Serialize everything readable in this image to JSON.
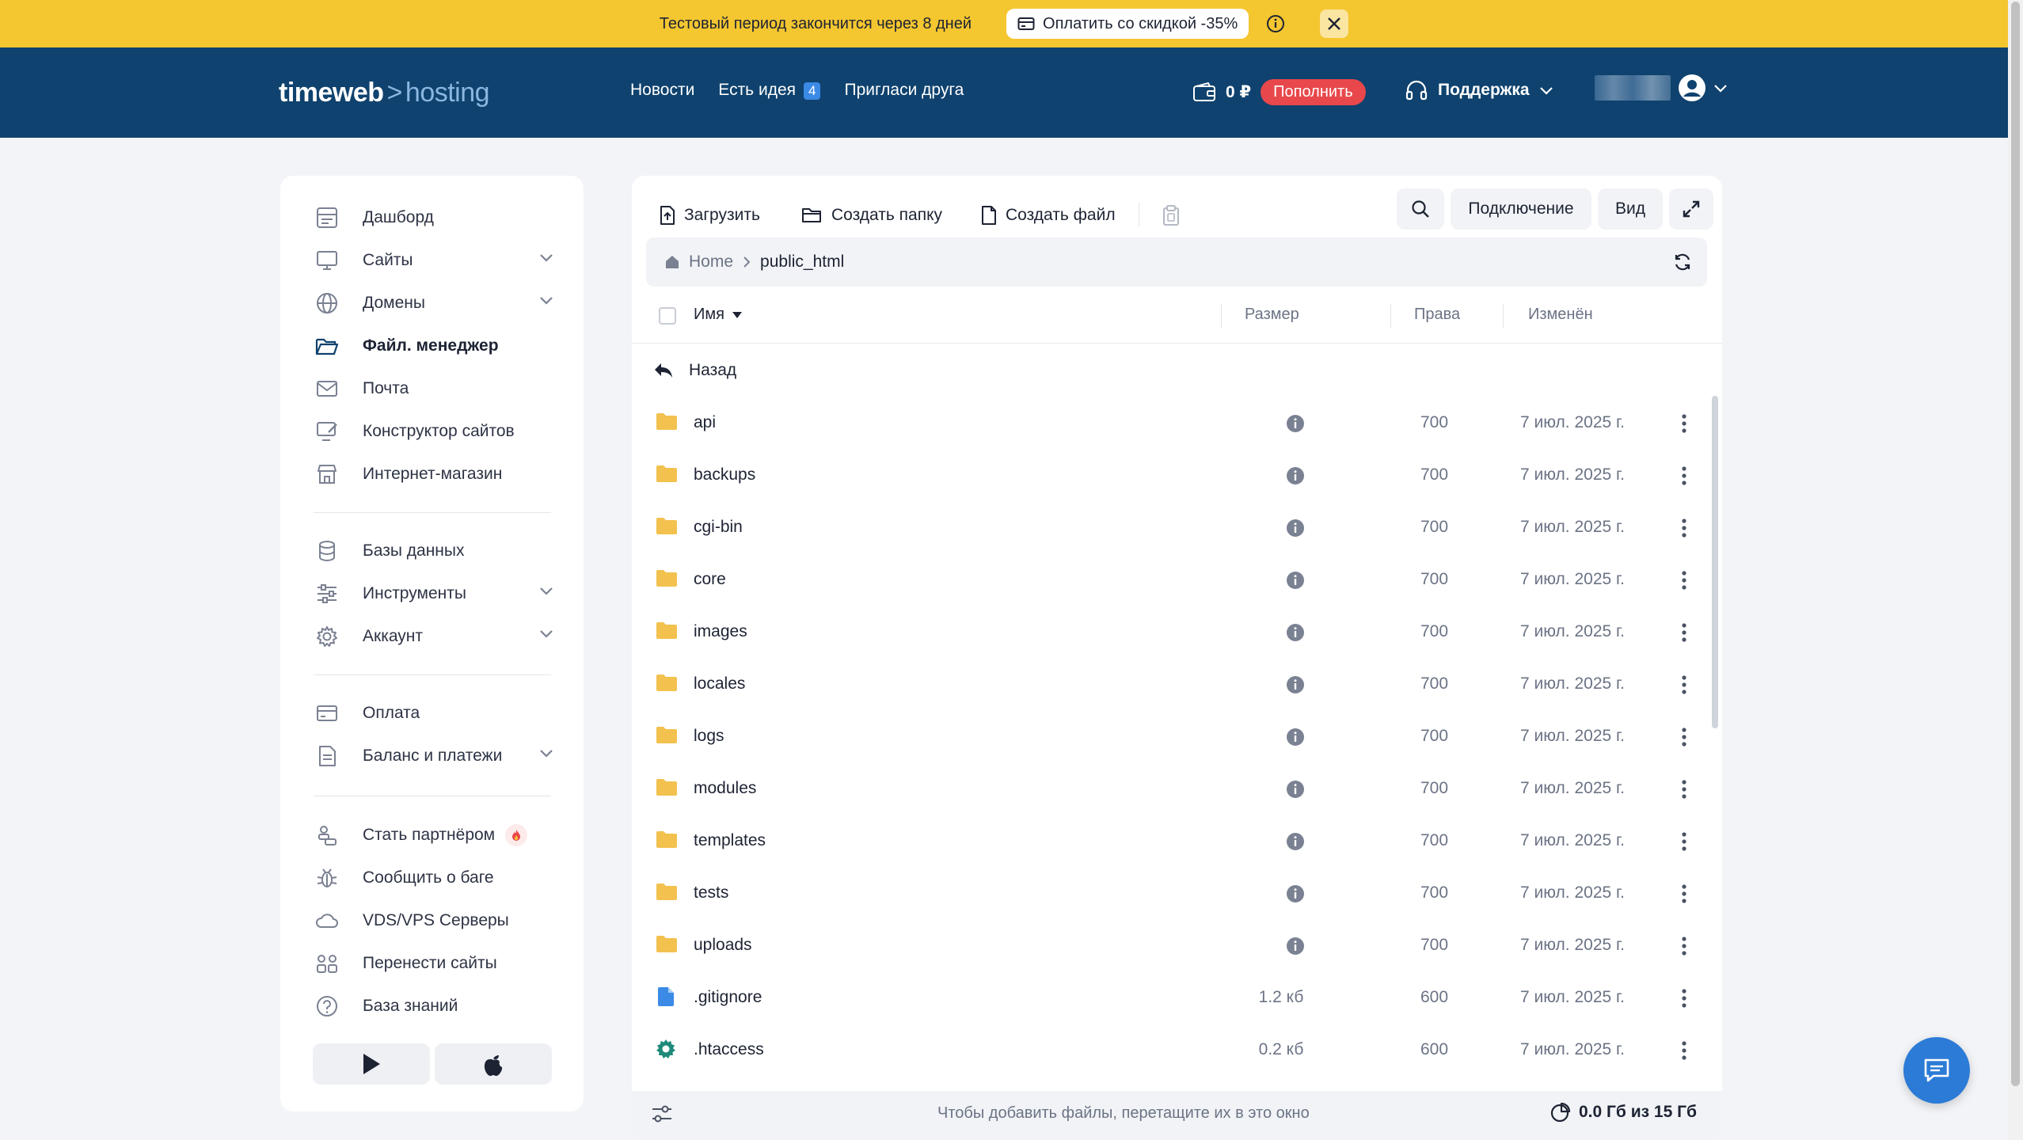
{
  "banner": {
    "text": "Тестовый период закончится через 8 дней",
    "pay_label": "Оплатить со скидкой -35%"
  },
  "header": {
    "logo_main": "timeweb",
    "logo_arrow": ">",
    "logo_sub": "hosting",
    "nav": [
      {
        "label": "Новости"
      },
      {
        "label": "Есть идея",
        "badge": "4"
      },
      {
        "label": "Пригласи друга"
      }
    ],
    "balance": "0 ₽",
    "topup_label": "Пополнить",
    "support_label": "Поддержка"
  },
  "sidebar": {
    "items": [
      {
        "label": "Дашборд",
        "icon": "dashboard-icon"
      },
      {
        "label": "Сайты",
        "icon": "monitor-icon",
        "expandable": true
      },
      {
        "label": "Домены",
        "icon": "globe-icon",
        "expandable": true
      },
      {
        "label": "Файл. менеджер",
        "icon": "folder-open-icon",
        "active": true
      },
      {
        "label": "Почта",
        "icon": "mail-icon"
      },
      {
        "label": "Конструктор сайтов",
        "icon": "builder-icon"
      },
      {
        "label": "Интернет-магазин",
        "icon": "store-icon"
      },
      {
        "label": "Базы данных",
        "icon": "database-icon"
      },
      {
        "label": "Инструменты",
        "icon": "sliders-icon",
        "expandable": true
      },
      {
        "label": "Аккаунт",
        "icon": "gear-icon",
        "expandable": true
      },
      {
        "label": "Оплата",
        "icon": "card-icon"
      },
      {
        "label": "Баланс и платежи",
        "icon": "document-icon",
        "expandable": true
      },
      {
        "label": "Стать партнёром",
        "icon": "partner-icon"
      },
      {
        "label": "Сообщить о баге",
        "icon": "bug-icon"
      },
      {
        "label": "VDS/VPS Серверы",
        "icon": "cloud-icon"
      },
      {
        "label": "Перенести сайты",
        "icon": "transfer-icon"
      },
      {
        "label": "База знаний",
        "icon": "help-icon"
      }
    ]
  },
  "toolbar": {
    "upload": "Загрузить",
    "new_folder": "Создать папку",
    "new_file": "Создать файл",
    "connection": "Подключение",
    "view": "Вид"
  },
  "breadcrumb": {
    "home": "Home",
    "current": "public_html"
  },
  "table": {
    "columns": {
      "name": "Имя",
      "size": "Размер",
      "perms": "Права",
      "modified": "Изменён"
    },
    "back_label": "Назад",
    "rows": [
      {
        "name": "api",
        "type": "folder",
        "size": "",
        "perms": "700",
        "modified": "7 июл. 2025 г."
      },
      {
        "name": "backups",
        "type": "folder",
        "size": "",
        "perms": "700",
        "modified": "7 июл. 2025 г."
      },
      {
        "name": "cgi-bin",
        "type": "folder",
        "size": "",
        "perms": "700",
        "modified": "7 июл. 2025 г."
      },
      {
        "name": "core",
        "type": "folder",
        "size": "",
        "perms": "700",
        "modified": "7 июл. 2025 г."
      },
      {
        "name": "images",
        "type": "folder",
        "size": "",
        "perms": "700",
        "modified": "7 июл. 2025 г."
      },
      {
        "name": "locales",
        "type": "folder",
        "size": "",
        "perms": "700",
        "modified": "7 июл. 2025 г."
      },
      {
        "name": "logs",
        "type": "folder",
        "size": "",
        "perms": "700",
        "modified": "7 июл. 2025 г."
      },
      {
        "name": "modules",
        "type": "folder",
        "size": "",
        "perms": "700",
        "modified": "7 июл. 2025 г."
      },
      {
        "name": "templates",
        "type": "folder",
        "size": "",
        "perms": "700",
        "modified": "7 июл. 2025 г."
      },
      {
        "name": "tests",
        "type": "folder",
        "size": "",
        "perms": "700",
        "modified": "7 июл. 2025 г."
      },
      {
        "name": "uploads",
        "type": "folder",
        "size": "",
        "perms": "700",
        "modified": "7 июл. 2025 г."
      },
      {
        "name": ".gitignore",
        "type": "file",
        "size": "1.2 кб",
        "perms": "600",
        "modified": "7 июл. 2025 г."
      },
      {
        "name": ".htaccess",
        "type": "config",
        "size": "0.2 кб",
        "perms": "600",
        "modified": "7 июл. 2025 г."
      }
    ]
  },
  "footer": {
    "hint": "Чтобы добавить файлы, перетащите их в это окно",
    "quota": "0.0 Гб из 15 Гб"
  },
  "colors": {
    "banner": "#f4c630",
    "header": "#0f426e",
    "accent_red": "#e8484b",
    "folder": "#f2c14e",
    "file": "#3a8ae6",
    "config": "#1f8a7a",
    "chat": "#2c7bd6"
  }
}
